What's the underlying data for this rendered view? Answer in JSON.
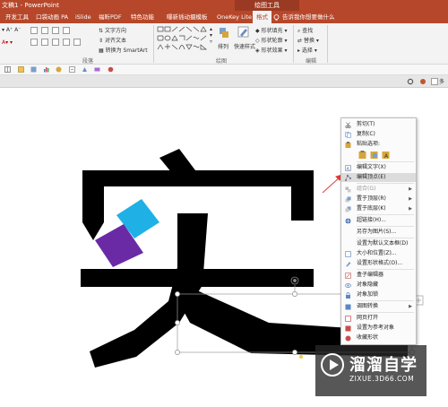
{
  "titlebar": {
    "title": "文稿1 - PowerPoint",
    "drawing_tools": "绘图工具"
  },
  "tabs": [
    "开发工具",
    "口袋动画 PA",
    "iSlide",
    "福昕PDF",
    "特色功能",
    "曝新插动摄模板",
    "OneKey Lite",
    "格式"
  ],
  "tell_me": "告诉我你想要做什么",
  "ribbon": {
    "text_direction": "文字方向",
    "align_text": "对齐文本",
    "smartart": "转换为 SmartArt",
    "paragraph_group": "段落",
    "arrange": "排列",
    "quick_styles": "快速样式",
    "shape_fill": "形状填充",
    "shape_outline": "形状轮廓",
    "shape_effects": "形状效果",
    "drawing_group": "绘图",
    "find": "查找",
    "replace": "替换",
    "select": "选择",
    "editing_group": "编辑"
  },
  "slide": {
    "big_char": "实"
  },
  "context_menu": {
    "items": [
      {
        "label": "剪切(T)",
        "icon": "scissors-icon",
        "color": "#5b5b5b"
      },
      {
        "label": "复制(C)",
        "icon": "copy-icon",
        "color": "#6a8fc7"
      },
      {
        "label": "粘贴选项:",
        "icon": "paste-icon",
        "color": "#d8a53a"
      },
      {
        "label": "",
        "icon": "paste-options-row",
        "color": "#d8a53a"
      },
      {
        "label": "编辑文字(X)",
        "icon": "edit-text-icon",
        "color": "#6b7fa6"
      },
      {
        "label": "编辑顶点(E)",
        "icon": "edit-points-icon",
        "color": "#6b7fa6"
      },
      {
        "label": "组合(G)",
        "icon": "group-icon",
        "color": "#9a9a9a"
      },
      {
        "label": "置于顶层(R)",
        "icon": "bring-front-icon",
        "color": "#7aa0c9"
      },
      {
        "label": "置于底层(K)",
        "icon": "send-back-icon",
        "color": "#7aa0c9"
      },
      {
        "label": "超链接(H)...",
        "icon": "hyperlink-icon",
        "color": "#4a78b5"
      },
      {
        "label": "另存为图片(S)...",
        "icon": "",
        "color": ""
      },
      {
        "label": "设置为默认文本框(D)",
        "icon": "",
        "color": ""
      },
      {
        "label": "大小和位置(Z)...",
        "icon": "size-icon",
        "color": "#7aa0c9"
      },
      {
        "label": "设置形状格式(O)...",
        "icon": "format-shape-icon",
        "color": "#7aa0c9"
      },
      {
        "label": "盒子编辑器",
        "icon": "box-editor-icon",
        "color": "#c96a6a"
      },
      {
        "label": "对象隐藏",
        "icon": "hide-icon",
        "color": "#5b88c4"
      },
      {
        "label": "对象加锁",
        "icon": "lock-icon",
        "color": "#5b88c4"
      },
      {
        "label": "调图转换",
        "icon": "convert-icon",
        "color": "#5b88c4"
      },
      {
        "label": "网页打开",
        "icon": "web-icon",
        "color": "#c94c4c"
      },
      {
        "label": "设置为参考对象",
        "icon": "reference-icon",
        "color": "#c94c4c"
      },
      {
        "label": "收藏形状",
        "icon": "favorite-icon",
        "color": "#c94c4c"
      }
    ]
  },
  "watermark": {
    "brand": "溜溜自学",
    "url": "ZIXUE.3D66.COM"
  },
  "colors": {
    "accent": "#b7472a",
    "shape_blue": "#1fb1e6",
    "shape_purple": "#6a2aa5"
  }
}
